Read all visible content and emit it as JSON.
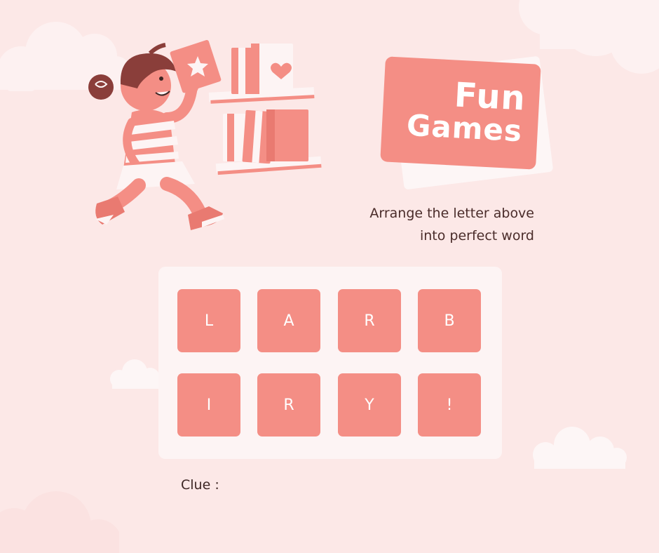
{
  "title": {
    "line1": "Fun",
    "line2": "Games"
  },
  "instruction": {
    "line1": "Arrange the letter above",
    "line2": "into perfect word"
  },
  "tiles": [
    "L",
    "A",
    "R",
    "B",
    "I",
    "R",
    "Y",
    "!"
  ],
  "clue": {
    "label": "Clue :"
  },
  "colors": {
    "background": "#fce8e7",
    "accent": "#f48e85",
    "board": "#fdf4f4",
    "text": "#4a2c2a"
  },
  "illustration": {
    "subject": "girl-carrying-book",
    "shelf_icons": [
      "star-icon",
      "heart-icon"
    ]
  }
}
